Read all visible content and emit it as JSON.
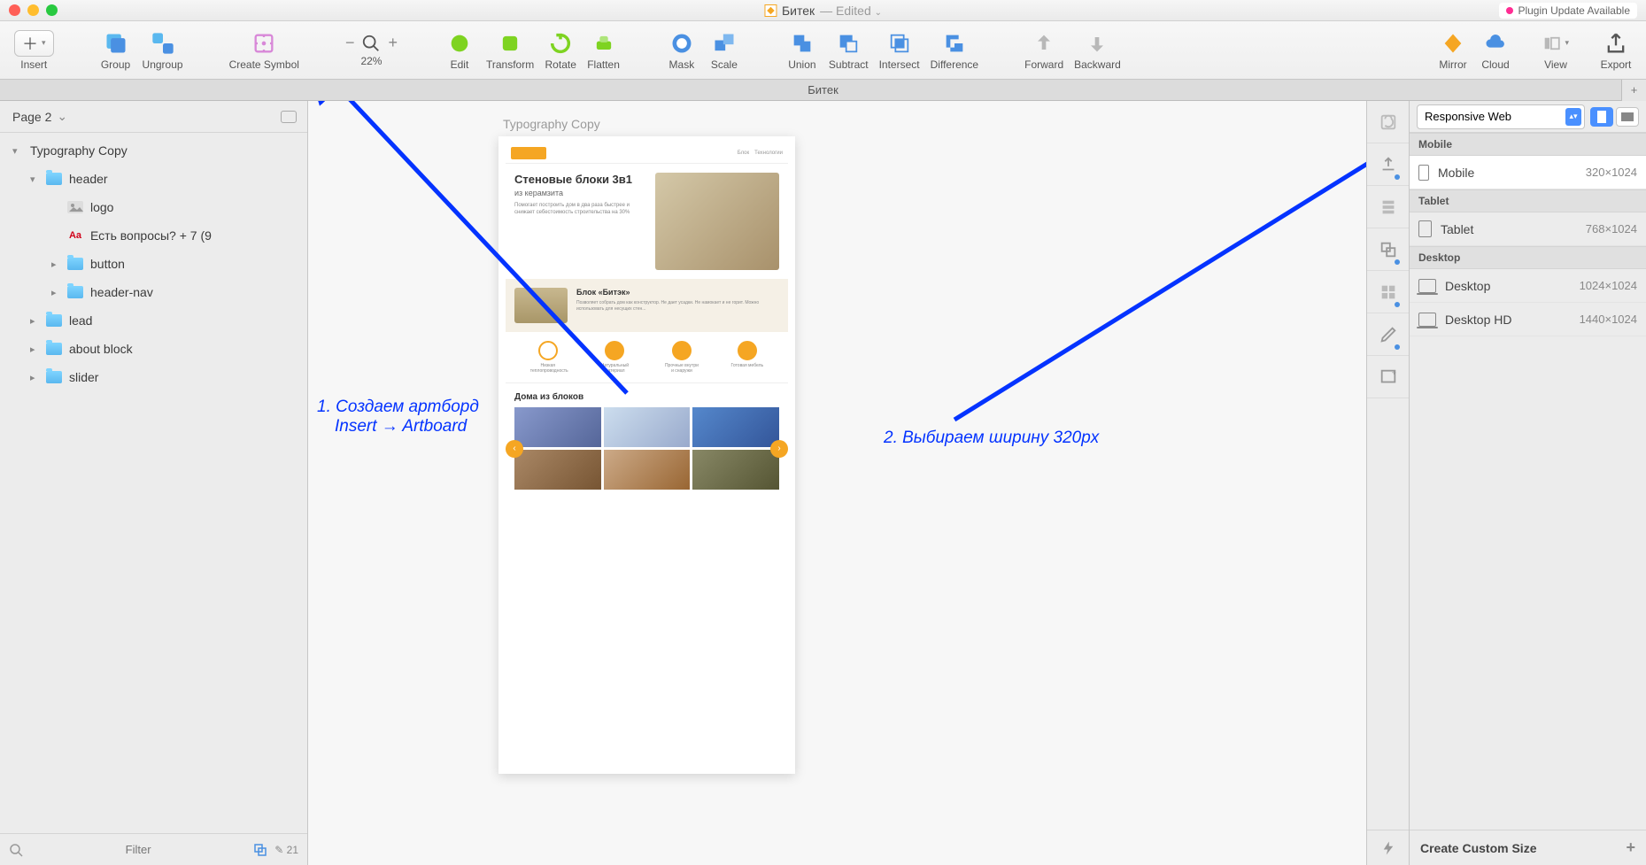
{
  "titlebar": {
    "doc_name": "Битек",
    "edited": "— Edited",
    "plugin_badge": "Plugin Update Available"
  },
  "toolbar": {
    "insert": "Insert",
    "group": "Group",
    "ungroup": "Ungroup",
    "create_symbol": "Create Symbol",
    "zoom_value": "22%",
    "edit": "Edit",
    "transform": "Transform",
    "rotate": "Rotate",
    "flatten": "Flatten",
    "mask": "Mask",
    "scale": "Scale",
    "union": "Union",
    "subtract": "Subtract",
    "intersect": "Intersect",
    "difference": "Difference",
    "forward": "Forward",
    "backward": "Backward",
    "mirror": "Mirror",
    "cloud": "Cloud",
    "view": "View",
    "export": "Export"
  },
  "tabbar": {
    "tab1": "Битек"
  },
  "left": {
    "page_label": "Page 2",
    "layers": {
      "l0": "Typography Copy",
      "l1": "header",
      "l2": "logo",
      "l3": "Есть вопросы? + 7 (9",
      "l4": "button",
      "l5": "header-nav",
      "l6": "lead",
      "l7": "about block",
      "l8": "slider"
    },
    "filter_placeholder": "Filter",
    "filter_count": "21"
  },
  "canvas": {
    "artboard_label": "Typography Copy",
    "hero_title": "Стеновые блоки 3в1",
    "hero_sub": "из керамзита",
    "hero_text": "Помогает построить дом в два раза быстрее и снижает себестоимость строительства на 30%",
    "block_title": "Блок «Битэк»",
    "gallery_title": "Дома из блоков"
  },
  "annotations": {
    "a1_l1": "1. Создаем артборд",
    "a1_l2": "Insert → Artboard",
    "a2": "2. Выбираем ширину 320px"
  },
  "inspector": {
    "preset_select": "Responsive Web",
    "sections": {
      "mobile_hdr": "Mobile",
      "tablet_hdr": "Tablet",
      "desktop_hdr": "Desktop"
    },
    "rows": {
      "mobile": "Mobile",
      "mobile_dims": "320×1024",
      "tablet": "Tablet",
      "tablet_dims": "768×1024",
      "desktop": "Desktop",
      "desktop_dims": "1024×1024",
      "desktop_hd": "Desktop HD",
      "desktop_hd_dims": "1440×1024"
    },
    "footer": "Create Custom Size"
  }
}
